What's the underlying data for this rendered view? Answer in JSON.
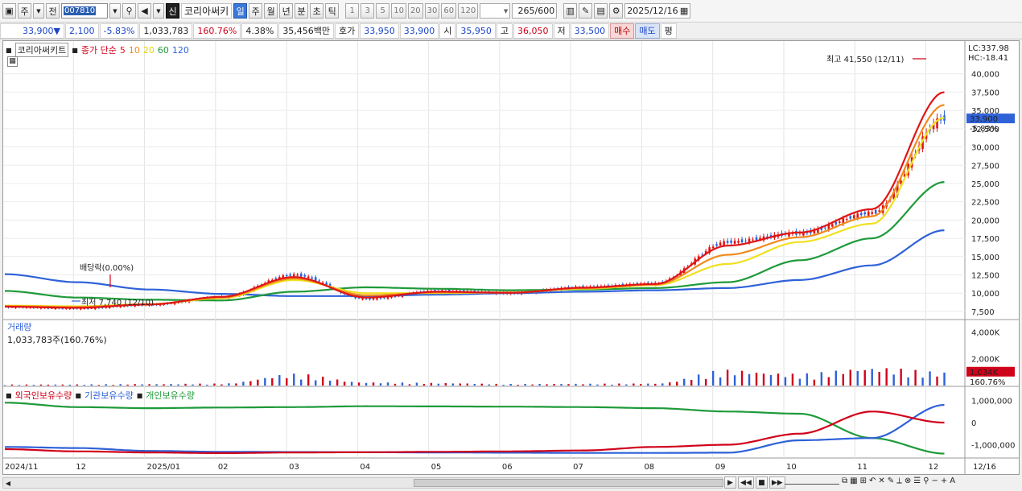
{
  "toolbar": {
    "mode_button": "주",
    "prev_button": "전",
    "code": "007810",
    "stock_name": "코리아써키",
    "new_badge": "신",
    "periods": [
      "일",
      "주",
      "월",
      "년",
      "분",
      "초",
      "틱"
    ],
    "selected_period": "일",
    "intervals": [
      "1",
      "3",
      "5",
      "10",
      "20",
      "30",
      "60",
      "120"
    ],
    "count": "265",
    "count_total": "/600",
    "date": "2025/12/16"
  },
  "quote": {
    "price": "33,900",
    "change_arrow": "▼",
    "change": "2,100",
    "change_pct": "-5.83%",
    "volume": "1,033,783",
    "volume_ratio": "160.76%",
    "turnover": "4.38%",
    "amount": "35,456백만",
    "bid_label": "호가",
    "ask_price": "33,950",
    "bid_price": "33,900",
    "open_label": "시",
    "open": "35,950",
    "high_label": "고",
    "high": "36,050",
    "low_label": "저",
    "low": "33,500",
    "buy_button": "매수",
    "sell_button": "매도",
    "avg_button": "평"
  },
  "price_panel": {
    "stock_tag": "코리아써키트",
    "legend_title": "종가 단순",
    "ma_periods": [
      "5",
      "10",
      "20",
      "60",
      "120"
    ],
    "ma_colors": [
      "#e01515",
      "#f08a1c",
      "#f0e020",
      "#1f9a3a",
      "#2f62d8"
    ],
    "lc_label": "LC:337.98",
    "hc_label": "HC:-18.41",
    "current_price_tag": "33,900",
    "current_pct_tag": "-5.83%",
    "high_annotation": "최고 41,550 (12/11)",
    "low_annotation": "최저 7,740 (12/10)",
    "dividend_annotation": "배당락(0.00%)",
    "y_ticks": [
      "40,000",
      "37,500",
      "35,000",
      "32,500",
      "30,000",
      "27,500",
      "25,000",
      "22,500",
      "20,000",
      "17,500",
      "15,000",
      "12,500",
      "10,000",
      "7,500"
    ]
  },
  "volume_panel": {
    "title": "거래량",
    "subtitle": "1,033,783주(160.76%)",
    "y_ticks": [
      "4,000K",
      "2,000K",
      "0"
    ],
    "current_tag": "1,034K",
    "current_pct_tag": "160.76%"
  },
  "holdings_panel": {
    "legend": [
      "외국인보유수량",
      "기관보유수량",
      "개인보유수량"
    ],
    "legend_colors": [
      "#d0021b",
      "#2f62d8",
      "#1f9a3a"
    ],
    "y_ticks": [
      "1,000,000",
      "0",
      "-1,000,000"
    ]
  },
  "x_axis": {
    "labels": [
      "2024/11",
      "12",
      "2025/01",
      "02",
      "03",
      "04",
      "05",
      "06",
      "07",
      "08",
      "09",
      "10",
      "11",
      "12"
    ],
    "right_label": "12/16"
  },
  "chart_data": {
    "type": "line",
    "title": "코리아써키트",
    "months": [
      "2024/11",
      "12",
      "2025/01",
      "02",
      "03",
      "04",
      "05",
      "06",
      "07",
      "08",
      "09",
      "10",
      "11",
      "12"
    ],
    "close": [
      8100,
      7900,
      8400,
      9400,
      12500,
      9200,
      10300,
      10000,
      10800,
      11300,
      17000,
      18200,
      21000,
      33900
    ],
    "ma5": [
      8150,
      8000,
      8450,
      9500,
      12200,
      9400,
      10200,
      10050,
      10750,
      11250,
      16500,
      18300,
      21500,
      37500
    ],
    "ma20": [
      8300,
      8200,
      8500,
      9300,
      11800,
      10000,
      10000,
      10100,
      10600,
      11100,
      14000,
      17000,
      19500,
      34000
    ],
    "ma60": [
      10300,
      9400,
      9100,
      9000,
      10200,
      10800,
      10600,
      10400,
      10500,
      10700,
      11500,
      14500,
      17500,
      25200
    ],
    "ma120": [
      12600,
      11500,
      10500,
      9900,
      9600,
      9600,
      9800,
      10000,
      10200,
      10400,
      10700,
      11800,
      13800,
      18600
    ],
    "volume_k": [
      80,
      90,
      120,
      150,
      900,
      250,
      200,
      120,
      140,
      160,
      1200,
      900,
      1400,
      1034
    ],
    "foreign_holdings": [
      -1200000,
      -1300000,
      -1350000,
      -1380000,
      -1350000,
      -1340000,
      -1320000,
      -1300000,
      -1260000,
      -1100000,
      -1000000,
      -500000,
      500000,
      0
    ],
    "institution_holdings": [
      -1100000,
      -1150000,
      -1280000,
      -1320000,
      -1330000,
      -1340000,
      -1350000,
      -1360000,
      -1370000,
      -1370000,
      -1360000,
      -800000,
      -700000,
      800000
    ],
    "individual_holdings": [
      900000,
      700000,
      650000,
      680000,
      700000,
      740000,
      730000,
      720000,
      700000,
      650000,
      500000,
      400000,
      -700000,
      -1400000
    ],
    "ylim": [
      6500,
      42500
    ]
  }
}
